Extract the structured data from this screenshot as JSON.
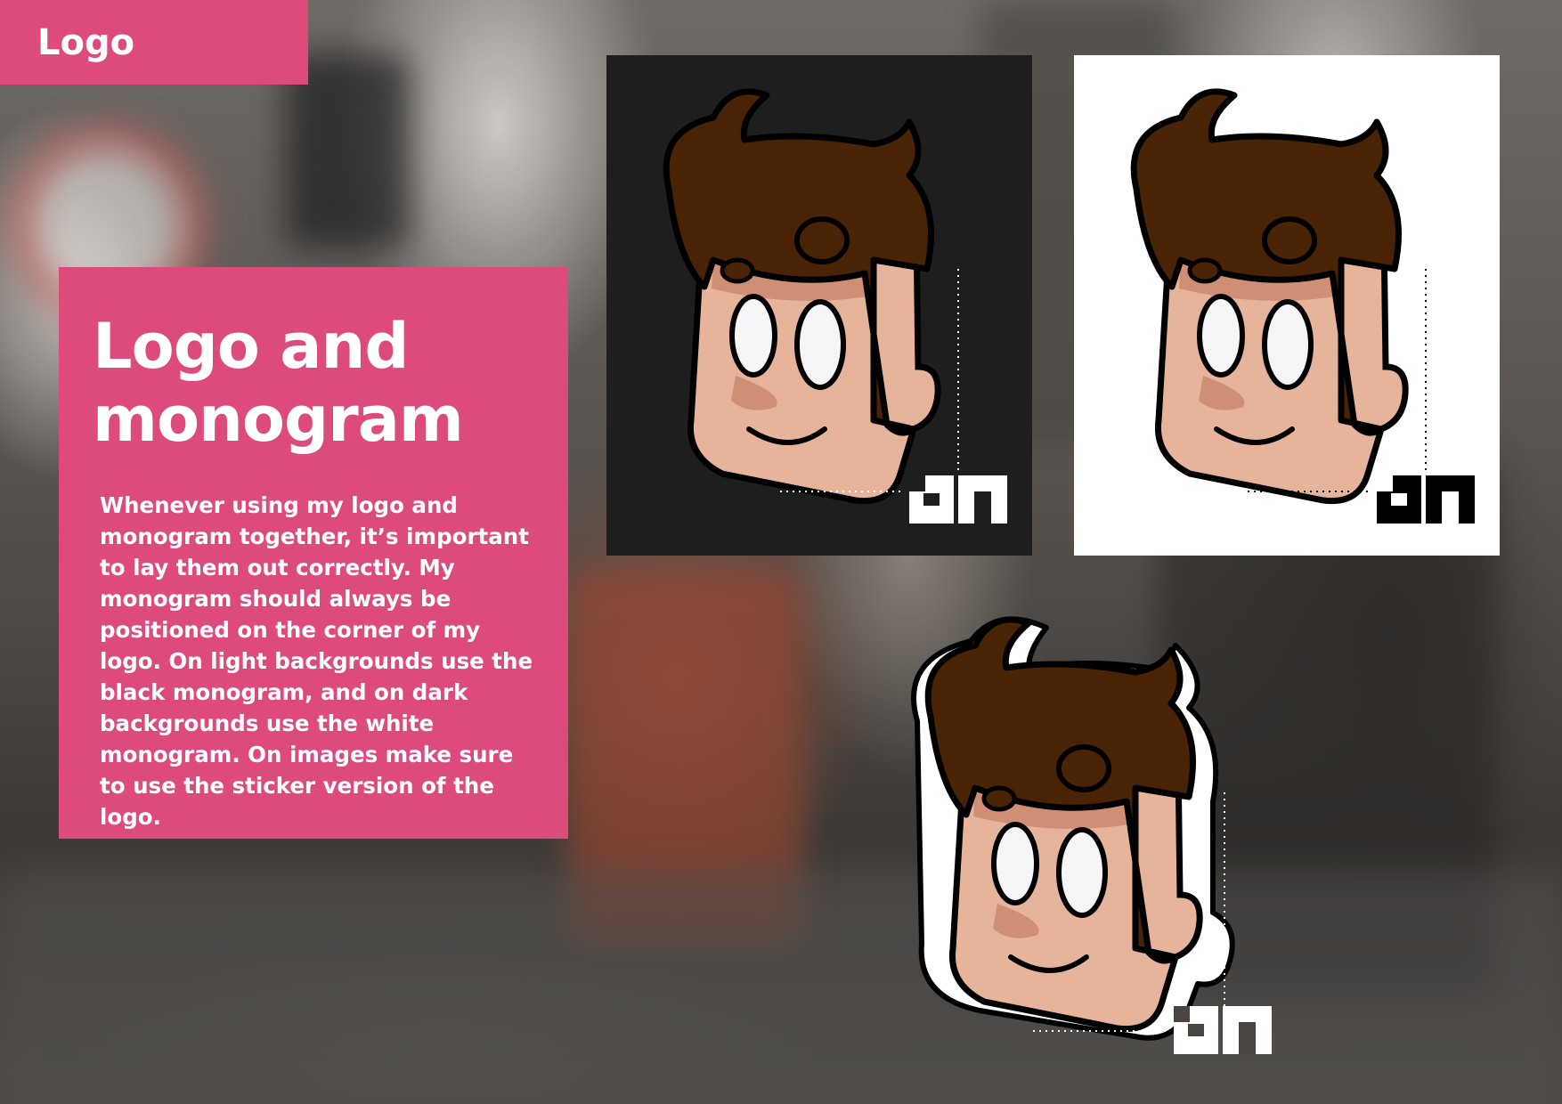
{
  "section_tag": "Logo",
  "card": {
    "title_line1": "Logo and",
    "title_line2": "monogram",
    "body": "Whenever using my logo and monogram together, it’s important to lay them out correctly. My monogram should always be positioned on the corner of my logo. On light backgrounds use the black monogram, and on dark backgrounds use the white monogram. On images make sure to use the sticker version of the logo."
  },
  "colors": {
    "accent": "#dc4b7c",
    "dark_panel": "#1e1e1e",
    "light_panel": "#ffffff",
    "hair": "#4a2305",
    "skin": "#e6b49a",
    "skin_shadow": "#cf8f74"
  },
  "logo_variants": [
    {
      "name": "dark-background",
      "monogram_color": "#ffffff"
    },
    {
      "name": "light-background",
      "monogram_color": "#000000"
    },
    {
      "name": "sticker",
      "monogram_color": "#ffffff"
    }
  ]
}
